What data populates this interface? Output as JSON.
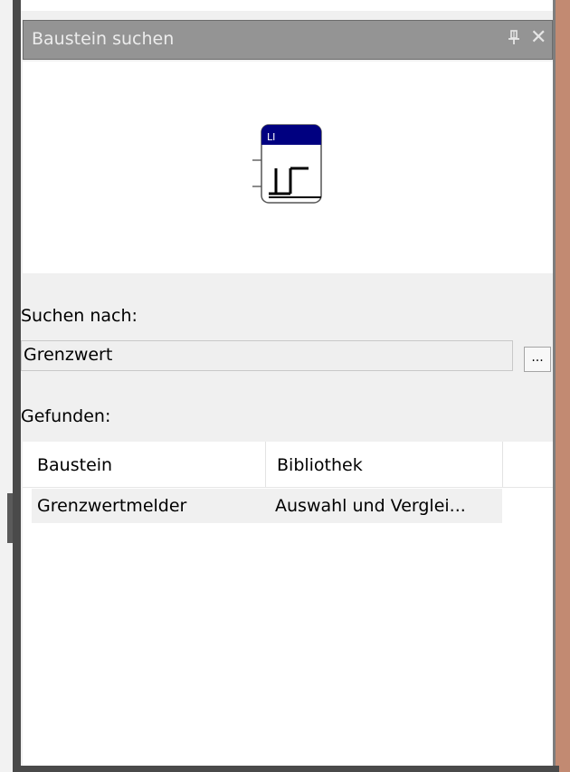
{
  "panel": {
    "title": "Baustein suchen",
    "pin_icon": "pin-icon",
    "close_icon": "close-icon",
    "close_glyph": "✕"
  },
  "preview": {
    "block_label": "LI",
    "block_icon": "limit-step-icon",
    "header_color": "#000080"
  },
  "search": {
    "label": "Suchen nach:",
    "value": "Grenzwert",
    "browse_label": "..."
  },
  "results": {
    "label": "Gefunden:",
    "columns": [
      "Baustein",
      "Bibliothek"
    ],
    "rows": [
      {
        "baustein": "Grenzwertmelder",
        "bibliothek": "Auswahl und Verglei..."
      }
    ]
  }
}
